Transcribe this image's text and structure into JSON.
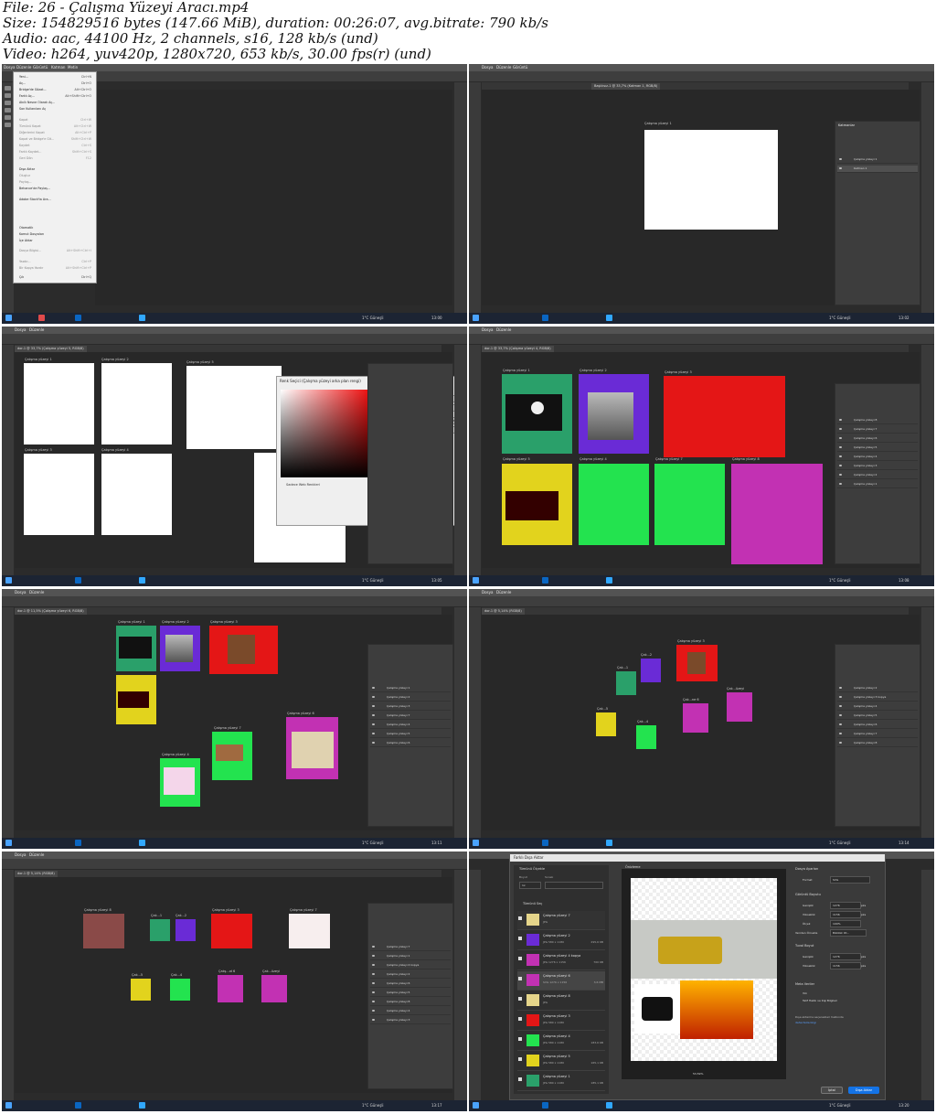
{
  "video_info": {
    "line1": "File: 26 - Çalışma Yüzeyi Aracı.mp4",
    "line2": "Size: 154829516 bytes (147.66 MiB), duration: 00:26:07, avg.bitrate: 790 kb/s",
    "line3": "Audio: aac, 44100 Hz, 2 channels, s16, 128 kb/s (und)",
    "line4": "Video: h264, yuv420p, 1280x720, 653 kb/s, 30.00 fps(r) (und)"
  },
  "app": {
    "menu": [
      "Dosya",
      "Düzenle",
      "Görüntü",
      "Katman",
      "Metin",
      "Seç",
      "Filtre",
      "3B",
      "Görünüm",
      "Pencere",
      "Yardım"
    ],
    "taskbar_weather": "1°C Güneşli",
    "colors": {
      "ps_bg": "#2b2b2b",
      "panel": "#3d3d3d",
      "taskbar": "#1c2433",
      "accent": "#1473e6"
    }
  },
  "frames": [
    {
      "id": "f1",
      "time": "13:00",
      "date": "22.05.2022",
      "file_menu": {
        "items": [
          {
            "label": "Yeni...",
            "sc": "Ctrl+N"
          },
          {
            "label": "Aç...",
            "sc": "Ctrl+O"
          },
          {
            "label": "Bridge'de Gözat...",
            "sc": "Alt+Ctrl+O"
          },
          {
            "label": "Farklı Aç...",
            "sc": "Alt+Shift+Ctrl+O"
          },
          {
            "label": "Akıllı Nesne Olarak Aç...",
            "sc": ""
          },
          {
            "label": "Son Kullanılanı Aç",
            "sc": ""
          },
          {
            "label": "Kapat",
            "sc": "Ctrl+W"
          },
          {
            "label": "Tümünü Kapat",
            "sc": "Alt+Ctrl+W"
          },
          {
            "label": "Diğerlerini Kapat",
            "sc": "Alt+Ctrl+P"
          },
          {
            "label": "Kapat ve Bridge'e Git...",
            "sc": "Shift+Ctrl+W"
          },
          {
            "label": "Kaydet",
            "sc": "Ctrl+S"
          },
          {
            "label": "Farklı Kaydet...",
            "sc": "Shift+Ctrl+S"
          },
          {
            "label": "Geri Dön",
            "sc": "F12"
          },
          {
            "label": "Dışa Aktar",
            "sc": ""
          },
          {
            "label": "Oluştur",
            "sc": ""
          },
          {
            "label": "Paylaş...",
            "sc": ""
          },
          {
            "label": "Behance'de Paylaş...",
            "sc": ""
          },
          {
            "label": "Adobe Stock'ta Ara...",
            "sc": ""
          },
          {
            "label": "Otomatik",
            "sc": ""
          },
          {
            "label": "Komut Dosyaları",
            "sc": ""
          },
          {
            "label": "İçe Aktar",
            "sc": ""
          },
          {
            "label": "Dosya Bilgisi...",
            "sc": "Alt+Shift+Ctrl+I"
          },
          {
            "label": "Yazdır...",
            "sc": "Ctrl+P"
          },
          {
            "label": "Bir Kopya Yazdır",
            "sc": "Alt+Shift+Ctrl+P"
          },
          {
            "label": "Çık",
            "sc": "Ctrl+Q"
          }
        ]
      }
    },
    {
      "id": "f2",
      "time": "13:02",
      "date": "22.05.2022",
      "tab": "Başlıksız-1 @ 33,7% (Katman 1, RGB/8)",
      "artboard_label": "Çalışma yüzeyi 1",
      "layers_title": "Katmanlar",
      "layers": [
        "Çalışma yüzeyi 1",
        "Katman 1"
      ]
    },
    {
      "id": "f3",
      "time": "13:05",
      "date": "22.05.2022",
      "tab": "dor-1 @ 33,7% (Çalışma yüzeyi 5, RGB/8)",
      "artboards": [
        "Çalışma yüzeyi 1",
        "Çalışma yüzeyi 2",
        "Çalışma yüzeyi 3",
        "Çalışma yüzeyi 4",
        "Çalışma yüzeyi 5"
      ],
      "picker": {
        "title": "Renk Seçici (Çalışma yüzeyi arka plan rengi)",
        "ok": "Tamam",
        "cancel": "İptal",
        "add_swatch": "Renk Örneklerine Ekle",
        "libraries": "Renk Kitaplıkları",
        "web_only": "Sadece Web Renkleri",
        "new_label": "yeni",
        "current_label": "geçerli"
      }
    },
    {
      "id": "f4",
      "time": "13:08",
      "date": "22.05.2022",
      "tab": "dor-1 @ 33,7% (Çalışma yüzeyi 4, RGB/8)",
      "artboards": [
        {
          "label": "Çalışma yüzeyi 1",
          "color": "#2aa06a"
        },
        {
          "label": "Çalışma yüzeyi 2",
          "color": "#6a2bd6"
        },
        {
          "label": "Çalışma yüzeyi 3",
          "color": "#e41616"
        },
        {
          "label": "Çalışma yüzeyi 5",
          "color": "#e2d31d"
        },
        {
          "label": "Çalışma yüzeyi 4",
          "color": "#23e34f"
        },
        {
          "label": "Çalışma yüzeyi 7",
          "color": "#23e34f"
        },
        {
          "label": "Çalışma yüzeyi 8",
          "color": "#c231b3"
        }
      ],
      "layers": [
        "Çalışma yüzeyi 8",
        "Çalışma yüzeyi 7",
        "Çalışma yüzeyi 6",
        "Çalışma yüzeyi 5",
        "Çalışma yüzeyi 4",
        "Çalışma yüzeyi 3",
        "Çalışma yüzeyi 2",
        "Çalışma yüzeyi 1"
      ]
    },
    {
      "id": "f5",
      "time": "13:11",
      "date": "22.05.2022",
      "tab": "dor-1 @ 11,5% (Çalışma yüzeyi 6, RGB/8)",
      "artboards": [
        {
          "label": "Çalışma yüzeyi 1",
          "color": "#2aa06a"
        },
        {
          "label": "Çalışma yüzeyi 2",
          "color": "#6a2bd6"
        },
        {
          "label": "Çalışma yüzeyi 3",
          "color": "#e41616"
        },
        {
          "label": "Çalışma yüzeyi 5",
          "color": "#e2d31d"
        },
        {
          "label": "Çalışma yüzeyi 7",
          "color": "#23e34f"
        },
        {
          "label": "Çalışma yüzeyi 4",
          "color": "#23e34f"
        },
        {
          "label": "Çalışma yüzeyi 6",
          "color": "#c231b3"
        }
      ],
      "layers": [
        "Çalışma yüzeyi 1",
        "Çalışma yüzeyi 2",
        "Çalışma yüzeyi 3",
        "Çalışma yüzeyi 7",
        "Çalışma yüzeyi 4",
        "Çalışma yüzeyi 5",
        "Çalışma yüzeyi 6"
      ]
    },
    {
      "id": "f6",
      "time": "13:14",
      "date": "22.05.2022",
      "tab": "dor-1 @ 5,14% (RGB/8)",
      "artboards": [
        {
          "label": "Çalışma yüzeyi 3",
          "color": "#e41616"
        },
        {
          "label": "Çalı...2",
          "color": "#6a2bd6"
        },
        {
          "label": "Çalı...1",
          "color": "#2aa06a"
        },
        {
          "label": "Çalı...5",
          "color": "#e2d31d"
        },
        {
          "label": "Çalı...4",
          "color": "#23e34f"
        },
        {
          "label": "Çalı...ne 6",
          "color": "#c231b3"
        },
        {
          "label": "Çalı...üzeyi",
          "color": "#c231b3"
        }
      ],
      "layers": [
        "Çalışma yüzeyi 2",
        "Çalışma yüzeyi 3 kopya",
        "Çalışma yüzeyi 4",
        "Çalışma yüzeyi 5",
        "Çalışma yüzeyi 6",
        "Çalışma yüzeyi 7",
        "Çalışma yüzeyi 8"
      ]
    },
    {
      "id": "f7",
      "time": "13:17",
      "date": "22.05.2022",
      "tab": "dor-1 @ 5,14% (RGB/8)",
      "artboards": [
        {
          "label": "Çalışma yüzeyi 8",
          "color": "#8a4a48"
        },
        {
          "label": "Çalı...1",
          "color": "#2aa06a"
        },
        {
          "label": "Çalı...2",
          "color": "#6a2bd6"
        },
        {
          "label": "Çalışma yüzeyi 3",
          "color": "#e41616"
        },
        {
          "label": "Çalışma yüzeyi 7",
          "color": "#f7eeee"
        },
        {
          "label": "Çalı...5",
          "color": "#e2d31d"
        },
        {
          "label": "Çalı...4",
          "color": "#23e34f"
        },
        {
          "label": "Çalış...ıd 6",
          "color": "#c231b3"
        },
        {
          "label": "Çalı...üzeyi",
          "color": "#c231b3"
        }
      ],
      "layers": [
        "Çalışma yüzeyi 7",
        "Çalışma yüzeyi 1",
        "Çalışma yüzeyi 4 kopya",
        "Çalışma yüzeyi 2",
        "Çalışma yüzeyi 6",
        "Çalışma yüzeyi 5",
        "Çalışma yüzeyi 8",
        "Çalışma yüzeyi 4",
        "Çalışma yüzeyi 3"
      ]
    },
    {
      "id": "f8",
      "time": "13:20",
      "date": "22.05.2022",
      "export": {
        "title": "Farklı Dışa Aktar",
        "scale_all": "Tümünü Ölçekle",
        "size_label": "Boyut",
        "suffix_label": "Sonek",
        "scale_value": "1x",
        "select_all": "Tümünü Seç",
        "preview_tab": "Önizleme",
        "zoom": "53,59%",
        "rows": [
          {
            "name": "Çalışma yüzeyi 7",
            "sub": "JPG",
            "size": "",
            "color": "#e5d58a"
          },
          {
            "name": "Çalışma yüzeyi 2",
            "sub": "JPG 580 x 1180",
            "size": "295,6 KB",
            "color": "#6a2bd6"
          },
          {
            "name": "Çalışma yüzeyi 4 kopya",
            "sub": "JPG 1276 x 1156",
            "size": "700 KB",
            "color": "#c231b3"
          },
          {
            "name": "Çalışma yüzeyi 6",
            "sub": "SVG 1276 x 1156",
            "size": "3,6 MB",
            "color": "#c231b3"
          },
          {
            "name": "Çalışma yüzeyi 8",
            "sub": "JPG",
            "size": "",
            "color": "#e5d58a"
          },
          {
            "name": "Çalışma yüzeyi 3",
            "sub": "JPG 580 x 1180",
            "size": "",
            "color": "#e41616"
          },
          {
            "name": "Çalışma yüzeyi 4",
            "sub": "JPG 580 x 1180",
            "size": "183,6 KB",
            "color": "#23e34f"
          },
          {
            "name": "Çalışma yüzeyi 5",
            "sub": "JPG 580 x 1180",
            "size": "165,1 KB",
            "color": "#e2d31d"
          },
          {
            "name": "Çalışma yüzeyi 1",
            "sub": "JPG 580 x 1180",
            "size": "185,1 KB",
            "color": "#2aa06a"
          }
        ],
        "settings": {
          "file_settings": "Dosya Ayarları",
          "format_label": "Format",
          "format_value": "SVG",
          "image_size": "Görüntü Boyutu",
          "width_label": "Genişlik",
          "width_value": "1276",
          "height_label": "Yükseklik",
          "height_value": "1156",
          "scale_label": "Ölçek",
          "scale_value": "100%",
          "resample_label": "Yeniden Örnekle",
          "resample_value": "Bikübik Ot...",
          "canvas_size": "Tuval Boyut",
          "canvas_w": "1276",
          "canvas_h": "1156",
          "metadata": "Meta Veriler",
          "meta_none": "Yok",
          "meta_copyright": "Telif Hakkı ve Kişi Bilgileri",
          "note": "Dışa aktarma seçenekleri hakkında",
          "link": "daha fazla bilgi",
          "px": "pks"
        },
        "cancel": "İptal",
        "export_btn": "Dışa Aktar"
      }
    }
  ]
}
